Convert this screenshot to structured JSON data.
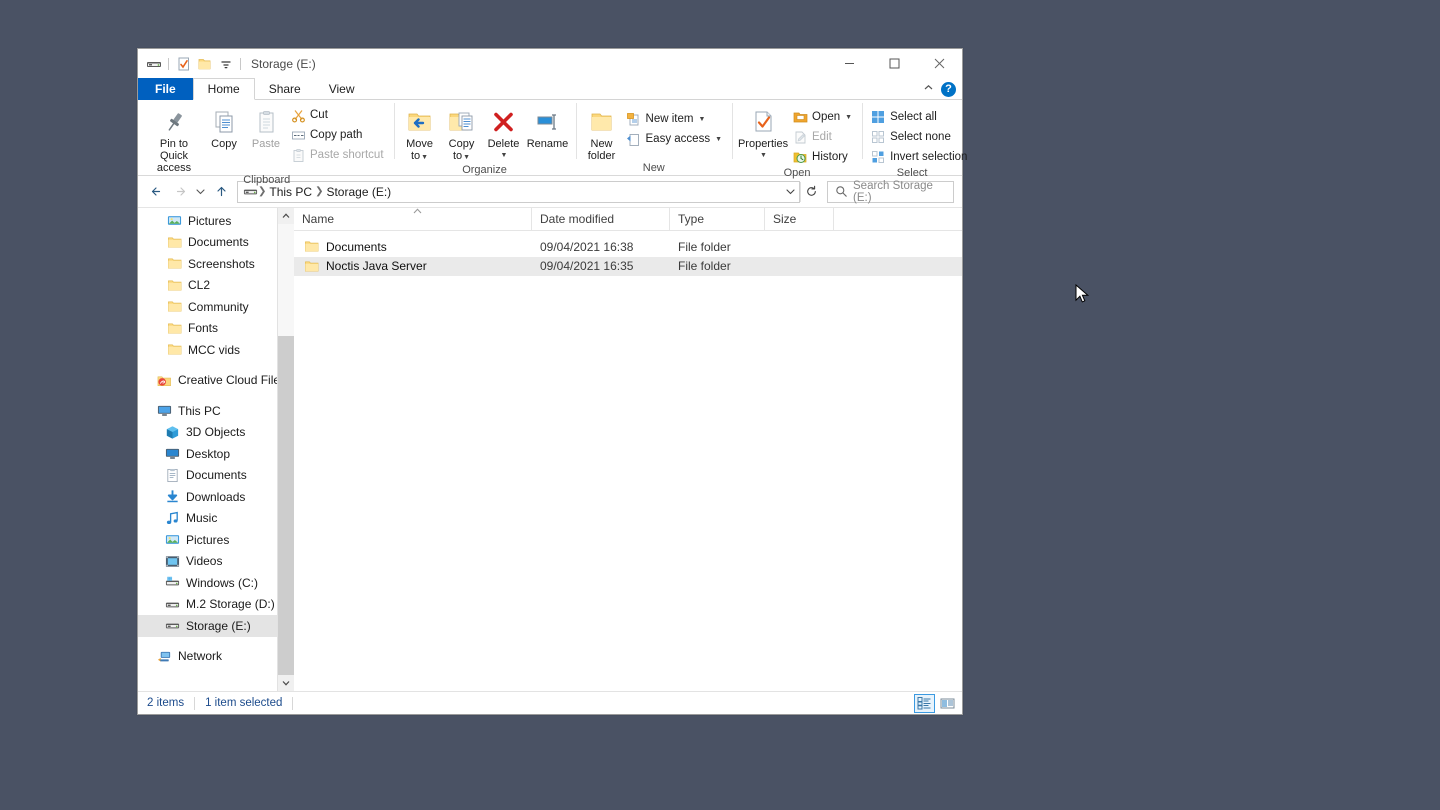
{
  "desktop": {
    "background": "#4a5264"
  },
  "window": {
    "title": "Storage (E:)",
    "quick_access": [
      {
        "name": "drive-icon",
        "label": "Storage (E:)"
      },
      {
        "name": "properties-icon",
        "label": "Properties"
      },
      {
        "name": "new-folder-icon",
        "label": "New folder"
      },
      {
        "name": "customize-qat-icon",
        "label": "Customize Quick Access Toolbar"
      }
    ],
    "controls": {
      "minimize": "Minimize",
      "maximize": "Maximize",
      "close": "Close"
    }
  },
  "ribbon": {
    "tabs": [
      {
        "label": "File",
        "active": false,
        "file": true
      },
      {
        "label": "Home",
        "active": true,
        "file": false
      },
      {
        "label": "Share",
        "active": false,
        "file": false
      },
      {
        "label": "View",
        "active": false,
        "file": false
      }
    ],
    "collapse_label": "Minimize the Ribbon",
    "help_label": "?",
    "groups": [
      {
        "name": "Clipboard",
        "big": [
          {
            "label_line1": "Pin to Quick",
            "label_line2": "access",
            "icon": "pin-icon",
            "disabled": false
          },
          {
            "label_line1": "Copy",
            "label_line2": "",
            "icon": "copy-icon",
            "disabled": false
          },
          {
            "label_line1": "Paste",
            "label_line2": "",
            "icon": "paste-icon",
            "disabled": true
          }
        ],
        "small": [
          {
            "label": "Cut",
            "icon": "scissors-icon",
            "disabled": false
          },
          {
            "label": "Copy path",
            "icon": "copy-path-icon",
            "disabled": false
          },
          {
            "label": "Paste shortcut",
            "icon": "paste-shortcut-icon",
            "disabled": true
          }
        ]
      },
      {
        "name": "Organize",
        "big": [
          {
            "label_line1": "Move",
            "label_line2": "to",
            "icon": "move-to-icon",
            "caret": true
          },
          {
            "label_line1": "Copy",
            "label_line2": "to",
            "icon": "copy-to-icon",
            "caret": true
          },
          {
            "label_line1": "Delete",
            "label_line2": "",
            "icon": "delete-icon",
            "caret": true
          },
          {
            "label_line1": "Rename",
            "label_line2": "",
            "icon": "rename-icon",
            "caret": false
          }
        ]
      },
      {
        "name": "New",
        "big": [
          {
            "label_line1": "New",
            "label_line2": "folder",
            "icon": "new-folder-large-icon",
            "caret": false
          }
        ],
        "small": [
          {
            "label": "New item",
            "icon": "new-item-icon",
            "caret": true,
            "disabled": false
          },
          {
            "label": "Easy access",
            "icon": "easy-access-icon",
            "caret": true,
            "disabled": false
          }
        ]
      },
      {
        "name": "Open",
        "big": [
          {
            "label_line1": "Properties",
            "label_line2": "",
            "icon": "properties-large-icon",
            "caret": true
          }
        ],
        "small": [
          {
            "label": "Open",
            "icon": "open-icon",
            "caret": true,
            "disabled": false
          },
          {
            "label": "Edit",
            "icon": "edit-icon",
            "caret": false,
            "disabled": true
          },
          {
            "label": "History",
            "icon": "history-icon",
            "caret": false,
            "disabled": false
          }
        ]
      },
      {
        "name": "Select",
        "small": [
          {
            "label": "Select all",
            "icon": "select-all-icon",
            "disabled": false
          },
          {
            "label": "Select none",
            "icon": "select-none-icon",
            "disabled": false
          },
          {
            "label": "Invert selection",
            "icon": "invert-selection-icon",
            "disabled": false
          }
        ]
      }
    ]
  },
  "addressbar": {
    "back_label": "Back",
    "forward_label": "Forward",
    "recent_label": "Recent locations",
    "up_label": "Up",
    "breadcrumbs": [
      {
        "label": "This PC",
        "icon": "drive-small-icon"
      },
      {
        "label": "Storage (E:)",
        "icon": ""
      }
    ],
    "dropdown_label": "Previous locations",
    "refresh_label": "Refresh",
    "search": {
      "placeholder": "Search Storage (E:)",
      "value": "",
      "icon": "search-icon"
    }
  },
  "navpane": {
    "items": [
      {
        "label": "Pictures",
        "icon": "pictures-icon",
        "indent": 1,
        "pinned": true,
        "selected": false
      },
      {
        "label": "Documents",
        "icon": "folder-icon",
        "indent": 1,
        "pinned": true,
        "selected": false
      },
      {
        "label": "Screenshots",
        "icon": "folder-icon",
        "indent": 1,
        "pinned": true,
        "selected": false
      },
      {
        "label": "CL2",
        "icon": "folder-icon",
        "indent": 1,
        "pinned": false,
        "selected": false
      },
      {
        "label": "Community",
        "icon": "folder-icon",
        "indent": 1,
        "pinned": false,
        "selected": false
      },
      {
        "label": "Fonts",
        "icon": "folder-icon",
        "indent": 1,
        "pinned": false,
        "selected": false
      },
      {
        "label": "MCC vids",
        "icon": "folder-icon",
        "indent": 1,
        "pinned": false,
        "selected": false
      },
      {
        "gap": true
      },
      {
        "label": "Creative Cloud Files",
        "icon": "creative-cloud-icon",
        "indent": 0,
        "pinned": false,
        "selected": false
      },
      {
        "gap": true
      },
      {
        "label": "This PC",
        "icon": "this-pc-icon",
        "indent": 0,
        "pinned": false,
        "selected": false
      },
      {
        "label": "3D Objects",
        "icon": "3d-objects-icon",
        "indent": 1,
        "pinned": false,
        "selected": false
      },
      {
        "label": "Desktop",
        "icon": "desktop-icon",
        "indent": 1,
        "pinned": false,
        "selected": false
      },
      {
        "label": "Documents",
        "icon": "documents-icon",
        "indent": 1,
        "pinned": false,
        "selected": false
      },
      {
        "label": "Downloads",
        "icon": "downloads-icon",
        "indent": 1,
        "pinned": false,
        "selected": false
      },
      {
        "label": "Music",
        "icon": "music-icon",
        "indent": 1,
        "pinned": false,
        "selected": false
      },
      {
        "label": "Pictures",
        "icon": "pictures-icon",
        "indent": 1,
        "pinned": false,
        "selected": false
      },
      {
        "label": "Videos",
        "icon": "videos-icon",
        "indent": 1,
        "pinned": false,
        "selected": false
      },
      {
        "label": "Windows (C:)",
        "icon": "os-drive-icon",
        "indent": 1,
        "pinned": false,
        "selected": false
      },
      {
        "label": "M.2 Storage (D:)",
        "icon": "drive-icon",
        "indent": 1,
        "pinned": false,
        "selected": false
      },
      {
        "label": "Storage (E:)",
        "icon": "drive-icon",
        "indent": 1,
        "pinned": false,
        "selected": true
      },
      {
        "gap": true
      },
      {
        "label": "Network",
        "icon": "network-icon",
        "indent": 0,
        "pinned": false,
        "selected": false
      }
    ]
  },
  "filelist": {
    "columns": [
      {
        "label": "Name",
        "key": "name"
      },
      {
        "label": "Date modified",
        "key": "date"
      },
      {
        "label": "Type",
        "key": "type"
      },
      {
        "label": "Size",
        "key": "size"
      }
    ],
    "sort": {
      "column": "Name",
      "direction": "ascending"
    },
    "rows": [
      {
        "name": "Documents",
        "date": "09/04/2021 16:38",
        "type": "File folder",
        "size": "",
        "icon": "folder-icon",
        "selected": false
      },
      {
        "name": "Noctis Java Server",
        "date": "09/04/2021 16:35",
        "type": "File folder",
        "size": "",
        "icon": "folder-icon",
        "selected": true
      }
    ]
  },
  "statusbar": {
    "item_count": "2 items",
    "selection": "1 item selected",
    "views": [
      {
        "name": "details-view",
        "label": "Details view",
        "active": true
      },
      {
        "name": "large-icons-view",
        "label": "Large icons view",
        "active": false
      }
    ]
  }
}
